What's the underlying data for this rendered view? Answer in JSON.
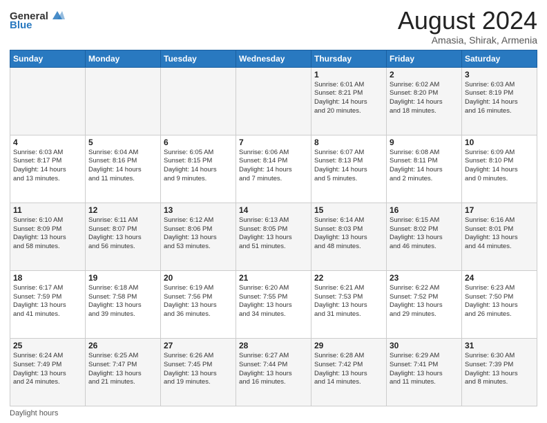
{
  "logo": {
    "general": "General",
    "blue": "Blue"
  },
  "title": "August 2024",
  "subtitle": "Amasia, Shirak, Armenia",
  "days_of_week": [
    "Sunday",
    "Monday",
    "Tuesday",
    "Wednesday",
    "Thursday",
    "Friday",
    "Saturday"
  ],
  "footer": "Daylight hours",
  "weeks": [
    [
      {
        "day": "",
        "info": ""
      },
      {
        "day": "",
        "info": ""
      },
      {
        "day": "",
        "info": ""
      },
      {
        "day": "",
        "info": ""
      },
      {
        "day": "1",
        "info": "Sunrise: 6:01 AM\nSunset: 8:21 PM\nDaylight: 14 hours\nand 20 minutes."
      },
      {
        "day": "2",
        "info": "Sunrise: 6:02 AM\nSunset: 8:20 PM\nDaylight: 14 hours\nand 18 minutes."
      },
      {
        "day": "3",
        "info": "Sunrise: 6:03 AM\nSunset: 8:19 PM\nDaylight: 14 hours\nand 16 minutes."
      }
    ],
    [
      {
        "day": "4",
        "info": "Sunrise: 6:03 AM\nSunset: 8:17 PM\nDaylight: 14 hours\nand 13 minutes."
      },
      {
        "day": "5",
        "info": "Sunrise: 6:04 AM\nSunset: 8:16 PM\nDaylight: 14 hours\nand 11 minutes."
      },
      {
        "day": "6",
        "info": "Sunrise: 6:05 AM\nSunset: 8:15 PM\nDaylight: 14 hours\nand 9 minutes."
      },
      {
        "day": "7",
        "info": "Sunrise: 6:06 AM\nSunset: 8:14 PM\nDaylight: 14 hours\nand 7 minutes."
      },
      {
        "day": "8",
        "info": "Sunrise: 6:07 AM\nSunset: 8:13 PM\nDaylight: 14 hours\nand 5 minutes."
      },
      {
        "day": "9",
        "info": "Sunrise: 6:08 AM\nSunset: 8:11 PM\nDaylight: 14 hours\nand 2 minutes."
      },
      {
        "day": "10",
        "info": "Sunrise: 6:09 AM\nSunset: 8:10 PM\nDaylight: 14 hours\nand 0 minutes."
      }
    ],
    [
      {
        "day": "11",
        "info": "Sunrise: 6:10 AM\nSunset: 8:09 PM\nDaylight: 13 hours\nand 58 minutes."
      },
      {
        "day": "12",
        "info": "Sunrise: 6:11 AM\nSunset: 8:07 PM\nDaylight: 13 hours\nand 56 minutes."
      },
      {
        "day": "13",
        "info": "Sunrise: 6:12 AM\nSunset: 8:06 PM\nDaylight: 13 hours\nand 53 minutes."
      },
      {
        "day": "14",
        "info": "Sunrise: 6:13 AM\nSunset: 8:05 PM\nDaylight: 13 hours\nand 51 minutes."
      },
      {
        "day": "15",
        "info": "Sunrise: 6:14 AM\nSunset: 8:03 PM\nDaylight: 13 hours\nand 48 minutes."
      },
      {
        "day": "16",
        "info": "Sunrise: 6:15 AM\nSunset: 8:02 PM\nDaylight: 13 hours\nand 46 minutes."
      },
      {
        "day": "17",
        "info": "Sunrise: 6:16 AM\nSunset: 8:01 PM\nDaylight: 13 hours\nand 44 minutes."
      }
    ],
    [
      {
        "day": "18",
        "info": "Sunrise: 6:17 AM\nSunset: 7:59 PM\nDaylight: 13 hours\nand 41 minutes."
      },
      {
        "day": "19",
        "info": "Sunrise: 6:18 AM\nSunset: 7:58 PM\nDaylight: 13 hours\nand 39 minutes."
      },
      {
        "day": "20",
        "info": "Sunrise: 6:19 AM\nSunset: 7:56 PM\nDaylight: 13 hours\nand 36 minutes."
      },
      {
        "day": "21",
        "info": "Sunrise: 6:20 AM\nSunset: 7:55 PM\nDaylight: 13 hours\nand 34 minutes."
      },
      {
        "day": "22",
        "info": "Sunrise: 6:21 AM\nSunset: 7:53 PM\nDaylight: 13 hours\nand 31 minutes."
      },
      {
        "day": "23",
        "info": "Sunrise: 6:22 AM\nSunset: 7:52 PM\nDaylight: 13 hours\nand 29 minutes."
      },
      {
        "day": "24",
        "info": "Sunrise: 6:23 AM\nSunset: 7:50 PM\nDaylight: 13 hours\nand 26 minutes."
      }
    ],
    [
      {
        "day": "25",
        "info": "Sunrise: 6:24 AM\nSunset: 7:49 PM\nDaylight: 13 hours\nand 24 minutes."
      },
      {
        "day": "26",
        "info": "Sunrise: 6:25 AM\nSunset: 7:47 PM\nDaylight: 13 hours\nand 21 minutes."
      },
      {
        "day": "27",
        "info": "Sunrise: 6:26 AM\nSunset: 7:45 PM\nDaylight: 13 hours\nand 19 minutes."
      },
      {
        "day": "28",
        "info": "Sunrise: 6:27 AM\nSunset: 7:44 PM\nDaylight: 13 hours\nand 16 minutes."
      },
      {
        "day": "29",
        "info": "Sunrise: 6:28 AM\nSunset: 7:42 PM\nDaylight: 13 hours\nand 14 minutes."
      },
      {
        "day": "30",
        "info": "Sunrise: 6:29 AM\nSunset: 7:41 PM\nDaylight: 13 hours\nand 11 minutes."
      },
      {
        "day": "31",
        "info": "Sunrise: 6:30 AM\nSunset: 7:39 PM\nDaylight: 13 hours\nand 8 minutes."
      }
    ]
  ]
}
